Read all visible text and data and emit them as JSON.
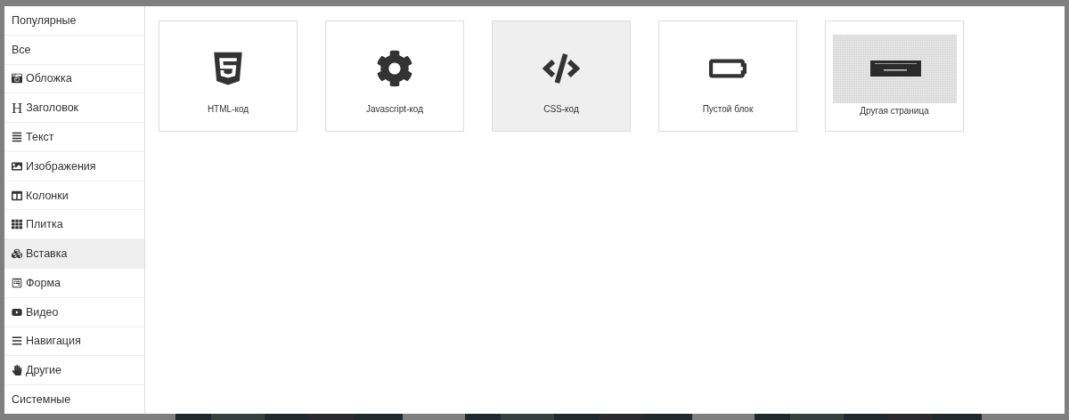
{
  "sidebar": {
    "items": [
      {
        "label": "Популярные",
        "selected": false
      },
      {
        "label": "Все",
        "selected": false
      },
      {
        "label": "Обложка",
        "selected": false
      },
      {
        "label": "Заголовок",
        "glyph": "H",
        "selected": false
      },
      {
        "label": "Текст",
        "selected": false
      },
      {
        "label": "Изображения",
        "selected": false
      },
      {
        "label": "Колонки",
        "selected": false
      },
      {
        "label": "Плитка",
        "selected": false
      },
      {
        "label": "Вставка",
        "selected": true
      },
      {
        "label": "Форма",
        "selected": false
      },
      {
        "label": "Видео",
        "selected": false
      },
      {
        "label": "Навигация",
        "selected": false
      },
      {
        "label": "Другие",
        "selected": false
      },
      {
        "label": "Системные",
        "selected": false
      }
    ]
  },
  "blocks": [
    {
      "label": "HTML-код",
      "kind": "icon",
      "selected": false
    },
    {
      "label": "Javascript-код",
      "kind": "icon",
      "selected": false
    },
    {
      "label": "CSS-код",
      "kind": "icon",
      "selected": true
    },
    {
      "label": "Пустой блок",
      "kind": "icon",
      "selected": false
    },
    {
      "label": "Другая страница",
      "kind": "preview",
      "selected": false
    }
  ]
}
